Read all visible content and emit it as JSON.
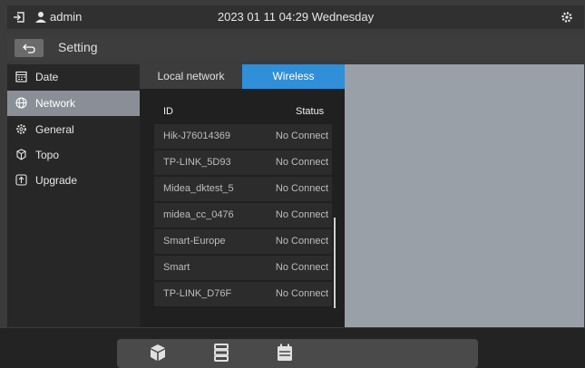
{
  "topbar": {
    "user": "admin",
    "datetime": "2023 01 11 04:29 Wednesday"
  },
  "setting": {
    "title": "Setting"
  },
  "sidebar": {
    "items": [
      {
        "label": "Date",
        "icon": "calendar-icon"
      },
      {
        "label": "Network",
        "icon": "globe-icon",
        "active": true
      },
      {
        "label": "General",
        "icon": "gear-icon"
      },
      {
        "label": "Topo",
        "icon": "topology-icon"
      },
      {
        "label": "Upgrade",
        "icon": "upgrade-icon"
      }
    ]
  },
  "tabs": {
    "local": "Local network",
    "wireless": "Wireless"
  },
  "table": {
    "headers": {
      "id": "ID",
      "status": "Status"
    },
    "rows": [
      {
        "id": "Hik-J76014369",
        "status": "No Connect"
      },
      {
        "id": "TP-LINK_5D93",
        "status": "No Connect"
      },
      {
        "id": "Midea_dktest_5",
        "status": "No Connect"
      },
      {
        "id": "midea_cc_0476",
        "status": "No Connect"
      },
      {
        "id": "Smart-Europe",
        "status": "No Connect"
      },
      {
        "id": "Smart",
        "status": "No Connect"
      },
      {
        "id": "TP-LINK_D76F",
        "status": "No Connect"
      }
    ]
  },
  "dock": {
    "icons": [
      "cube-icon",
      "server-icon",
      "calendar-icon"
    ]
  },
  "colors": {
    "accent": "#2f8fd8",
    "active_nav": "#8a8f97",
    "background": "#3b3b3b"
  }
}
